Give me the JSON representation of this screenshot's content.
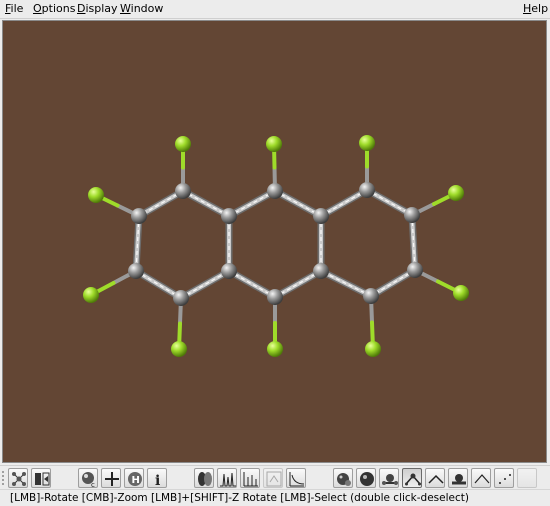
{
  "menu": {
    "file": "File",
    "options": "Options",
    "display": "Display",
    "window": "Window",
    "help": "Help"
  },
  "viewport": {
    "background": "#634634",
    "carbon_color": "#8a8a8a",
    "fluorine_color": "#9fdc2a"
  },
  "toolbar": {
    "buttons": [
      "molecule-view-icon",
      "split-view-icon",
      "sphere-model-icon",
      "add-cross-icon",
      "hydrogen-icon",
      "info-icon",
      "orbital-icon",
      "spectrum-icon",
      "bar-graph-icon",
      "coordinates-icon",
      "plot-icon",
      "atom-sphere-icon",
      "ball-icon",
      "ball-stick-icon",
      "bond-angle-icon",
      "angle-icon",
      "tube-icon",
      "wireframe-icon",
      "dots-icon",
      "blank-icon"
    ]
  },
  "status": {
    "text": "[LMB]-Rotate    [CMB]-Zoom    [LMB]+[SHIFT]-Z Rotate    [LMB]-Select (double click-deselect)"
  }
}
